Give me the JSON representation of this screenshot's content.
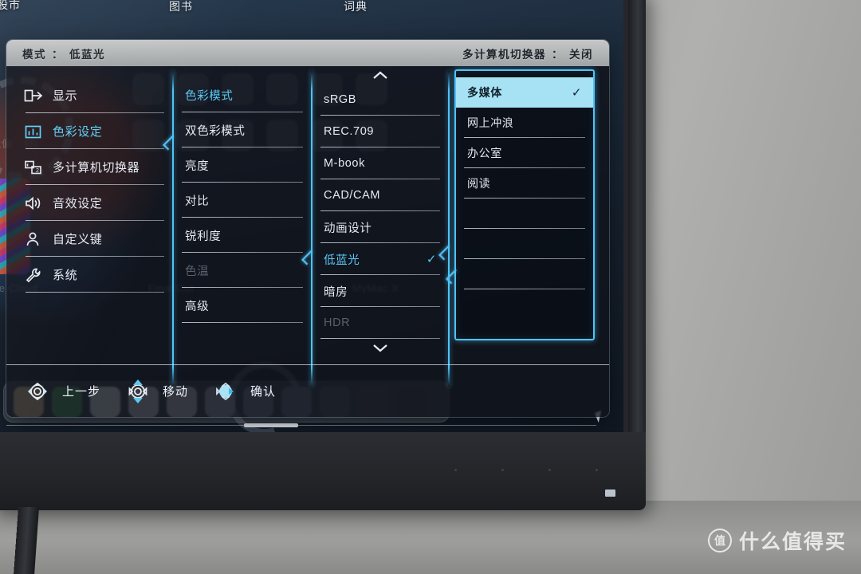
{
  "desktop": {
    "icon_labels": [
      "股市",
      "图书",
      "词典"
    ],
    "bg_texts": [
      "就偏",
      "好i",
      "tive Cloud",
      "Final Cut",
      "MyMac X"
    ]
  },
  "osd": {
    "header": {
      "mode_label": "模式",
      "colon": "：",
      "mode_value": "低蓝光",
      "kvm_label": "多计算机切换器",
      "kvm_colon": "：",
      "kvm_value": "关闭"
    },
    "sidebar": {
      "items": [
        {
          "label": "显示",
          "icon": "input-arrow-icon",
          "selected": false
        },
        {
          "label": "色彩设定",
          "icon": "color-bars-icon",
          "selected": true
        },
        {
          "label": "多计算机切换器",
          "icon": "kvm-switch-icon",
          "selected": false
        },
        {
          "label": "音效设定",
          "icon": "speaker-icon",
          "selected": false
        },
        {
          "label": "自定义键",
          "icon": "user-icon",
          "selected": false
        },
        {
          "label": "系统",
          "icon": "wrench-icon",
          "selected": false
        }
      ]
    },
    "column2": {
      "items": [
        {
          "label": "色彩模式",
          "selected": true,
          "disabled": false
        },
        {
          "label": "双色彩模式",
          "selected": false,
          "disabled": false
        },
        {
          "label": "亮度",
          "selected": false,
          "disabled": false
        },
        {
          "label": "对比",
          "selected": false,
          "disabled": false
        },
        {
          "label": "锐利度",
          "selected": false,
          "disabled": false
        },
        {
          "label": "色温",
          "selected": false,
          "disabled": true
        },
        {
          "label": "高级",
          "selected": false,
          "disabled": false
        }
      ]
    },
    "column3": {
      "scroll_up": "▲",
      "scroll_down": "▼",
      "items": [
        {
          "label": "sRGB",
          "selected": false,
          "disabled": false,
          "checked": false
        },
        {
          "label": "REC.709",
          "selected": false,
          "disabled": false,
          "checked": false
        },
        {
          "label": "M-book",
          "selected": false,
          "disabled": false,
          "checked": false
        },
        {
          "label": "CAD/CAM",
          "selected": false,
          "disabled": false,
          "checked": false
        },
        {
          "label": "动画设计",
          "selected": false,
          "disabled": false,
          "checked": false
        },
        {
          "label": "低蓝光",
          "selected": true,
          "disabled": false,
          "checked": true
        },
        {
          "label": "暗房",
          "selected": false,
          "disabled": false,
          "checked": false
        },
        {
          "label": "HDR",
          "selected": false,
          "disabled": true,
          "checked": false
        }
      ]
    },
    "column4": {
      "items": [
        {
          "label": "多媒体",
          "highlighted": true,
          "checked": true
        },
        {
          "label": "网上冲浪",
          "highlighted": false,
          "checked": false
        },
        {
          "label": "办公室",
          "highlighted": false,
          "checked": false
        },
        {
          "label": "阅读",
          "highlighted": false,
          "checked": false
        }
      ]
    },
    "footer": {
      "buttons": [
        {
          "label": "上一步",
          "icon": "dpad-back-icon"
        },
        {
          "label": "移动",
          "icon": "dpad-move-icon"
        },
        {
          "label": "确认",
          "icon": "dpad-confirm-icon"
        }
      ]
    },
    "colors": {
      "accent_cyan": "#4fc3f7",
      "selected_text": "#59c8f5",
      "highlight_fill": "#a6e2f3",
      "header_bar": "#d6d8d6",
      "panel_bg": "#10131a"
    }
  },
  "watermark": {
    "badge": "值",
    "text": "什么值得买"
  }
}
